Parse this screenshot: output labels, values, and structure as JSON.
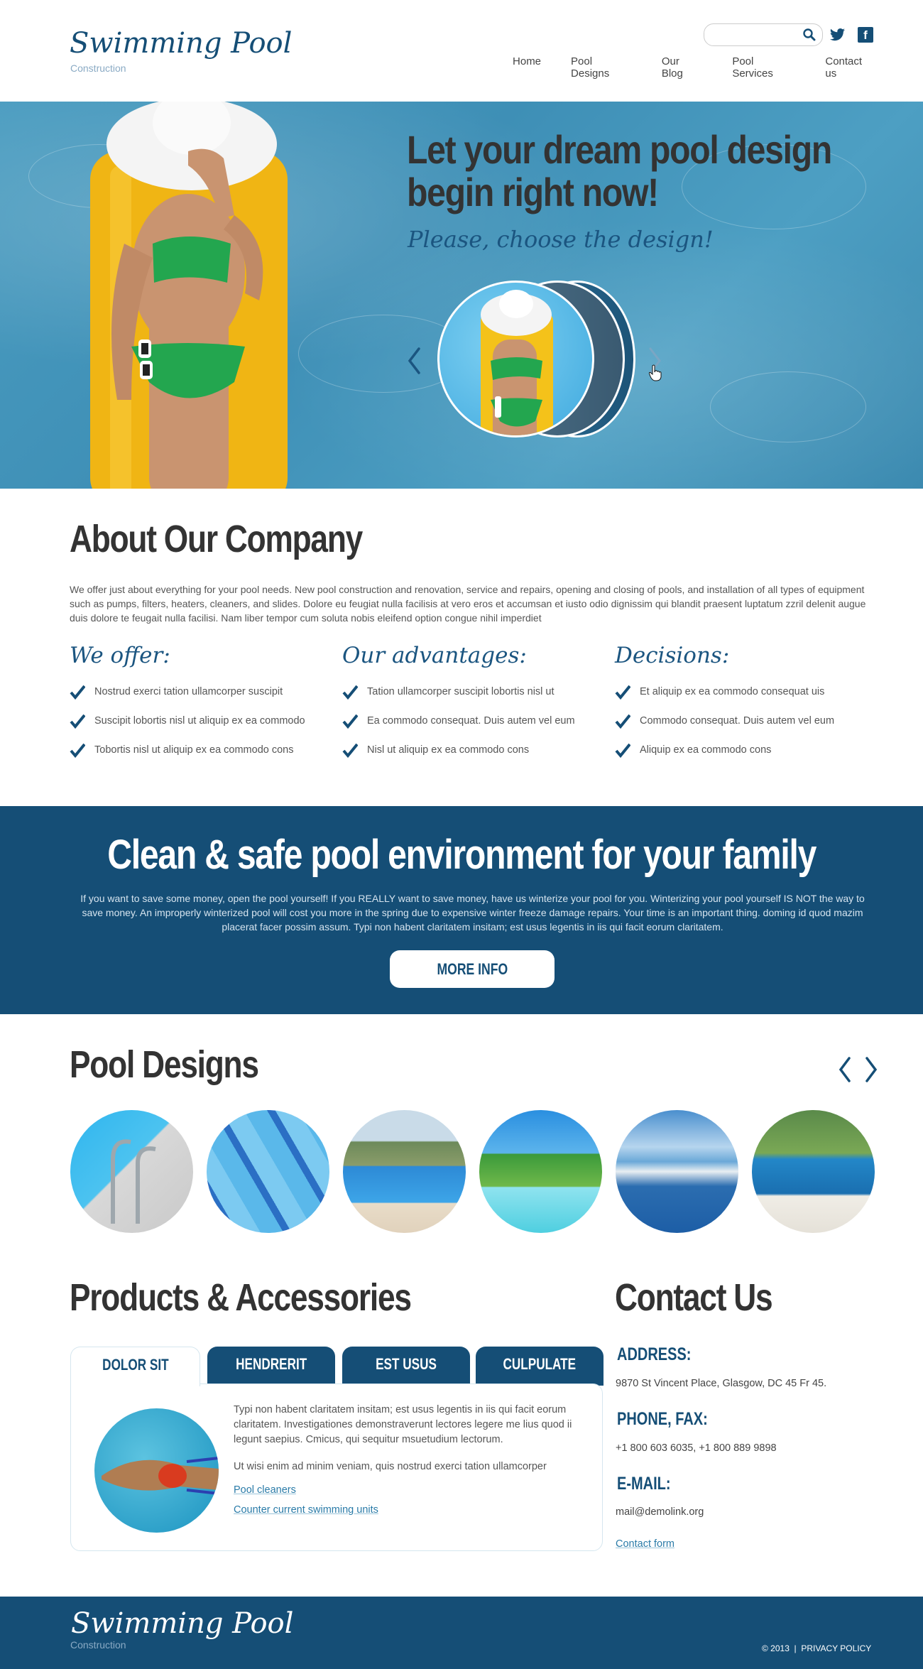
{
  "header": {
    "logo_title": "Swimming Pool",
    "logo_subtitle": "Construction",
    "search": {
      "value": "",
      "placeholder": "",
      "icon": "search-icon"
    },
    "social": [
      {
        "name": "twitter-icon"
      },
      {
        "name": "facebook-icon",
        "glyph": "f"
      }
    ],
    "nav": [
      "Home",
      "Pool Designs",
      "Our Blog",
      "Pool Services",
      "Contact us"
    ]
  },
  "hero": {
    "title_line1": "Let your dream pool design",
    "title_line2": "begin right now!",
    "subtitle": "Please, choose the design!",
    "prev_icon": "chevron-left-icon",
    "next_icon": "chevron-right-icon"
  },
  "about": {
    "title": "About Our Company",
    "text": "We offer just about everything for your pool needs. New pool construction and renovation, service and repairs, opening and closing of pools, and installation of all types of equipment such as pumps, filters, heaters, cleaners, and slides. Dolore eu feugiat nulla facilisis at vero eros et accumsan et iusto odio dignissim qui blandit praesent luptatum zzril delenit augue duis dolore te feugait nulla facilisi. Nam liber tempor cum soluta nobis eleifend option congue nihil imperdiet",
    "columns": [
      {
        "title": "We offer:",
        "items": [
          "Nostrud exerci tation ullamcorper suscipit",
          "Suscipit lobortis nisl ut aliquip ex ea commodo",
          "Tobortis nisl ut aliquip ex ea commodo cons"
        ]
      },
      {
        "title": "Our advantages:",
        "items": [
          "Tation ullamcorper suscipit lobortis nisl ut",
          "Ea commodo consequat. Duis autem vel eum",
          "Nisl ut aliquip ex ea commodo cons"
        ]
      },
      {
        "title": "Decisions:",
        "items": [
          "Et aliquip ex ea commodo consequat uis",
          "Commodo consequat. Duis autem vel eum",
          "Aliquip ex ea commodo cons"
        ]
      }
    ]
  },
  "banner": {
    "title": "Clean & safe pool environment for your family",
    "text": "If you want to save some money, open the pool yourself! If you REALLY want to save money, have us winterize your pool for you. Winterizing your pool yourself IS NOT the way to save money. An improperly winterized pool will cost you more in the spring due to expensive winter freeze damage repairs. Your time is an important thing. doming id quod mazim placerat facer possim assum. Typi non habent claritatem insitam; est usus legentis in iis qui facit eorum claritatem.",
    "button": "MORE INFO",
    "bg_color": "#154e76"
  },
  "designs": {
    "title": "Pool Designs",
    "thumbnails": [
      "pool-ladder",
      "mosaic-tiles",
      "resort-pool-with-jacuzzi",
      "palm-tree-pool",
      "infinity-pool-sea-view",
      "screened-pool-with-spa"
    ]
  },
  "products": {
    "title": "Products & Accessories",
    "tabs": [
      {
        "label": "DOLOR SIT",
        "active": true
      },
      {
        "label": "HENDRERIT",
        "active": false
      },
      {
        "label": "EST USUS",
        "active": false
      },
      {
        "label": "CULPULATE",
        "active": false
      }
    ],
    "panel_text": "Typi non habent claritatem insitam; est usus legentis in iis qui facit eorum claritatem. Investigationes demonstraverunt lectores legere me lius quod ii legunt saepius. Cmicus, qui sequitur msuetudium lectorum.",
    "panel_text2": "Ut wisi enim ad minim veniam, quis nostrud exerci tation ullamcorper",
    "links": [
      "Pool cleaners",
      "Counter current swimming units"
    ]
  },
  "contact": {
    "title": "Contact Us",
    "address_label": "ADDRESS:",
    "address": "9870 St Vincent Place, Glasgow, DC 45 Fr 45.",
    "phone_label": "PHONE, FAX:",
    "phone": "+1 800 603 6035, +1 800 889 9898",
    "email_label": "E-MAIL:",
    "email": "mail@demolink.org",
    "form_link": "Contact form"
  },
  "footer": {
    "logo_title": "Swimming Pool",
    "logo_subtitle": "Construction",
    "copyright": "© 2013",
    "separator": "|",
    "privacy": "PRIVACY POLICY"
  },
  "colors": {
    "brand": "#154e76",
    "link": "#2a7ba8",
    "text": "#555555",
    "heading": "#333333"
  }
}
